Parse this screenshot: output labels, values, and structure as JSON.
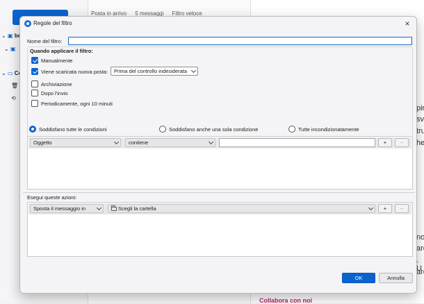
{
  "background": {
    "list_header": {
      "folder": "Posta in arrivo",
      "count": "5 messaggi",
      "quick_filter": "Filtro veloce"
    },
    "sidebar_fragments": [
      "be",
      "Ce"
    ],
    "reading_fragments": [
      "pir",
      "sv",
      "tru",
      "he",
      "no?",
      "are",
      ". U",
      "are"
    ],
    "reading_link": "Collabora con noi"
  },
  "dialog": {
    "title": "Regole del filtro",
    "name_label": "Nome del filtro:",
    "name_value": "",
    "when_heading": "Quando applicare il filtro:",
    "triggers": [
      {
        "label": "Manualmente",
        "checked": true
      },
      {
        "label": "Viene scaricata nuova posta:",
        "checked": true
      },
      {
        "label": "Archiviazione",
        "checked": false
      },
      {
        "label": "Dopo l'invio",
        "checked": false
      },
      {
        "label": "Periodicamente, ogni 10 minuti",
        "checked": false
      }
    ],
    "new_mail_timing": "Prima del controllo indesiderata",
    "match_options": [
      {
        "label": "Soddisfano tutte le condizioni",
        "selected": true
      },
      {
        "label": "Soddisfano anche una sola condizione",
        "selected": false
      },
      {
        "label": "Tutte incondizionatamente",
        "selected": false
      }
    ],
    "condition": {
      "field": "Oggetto",
      "operator": "contiene",
      "value": ""
    },
    "add_label": "+",
    "remove_label": "−",
    "actions_heading": "Esegui queste azioni:",
    "action": {
      "type": "Sposta il messaggio in",
      "target": "Scegli la cartella"
    },
    "ok_label": "OK",
    "cancel_label": "Annulla",
    "close_glyph": "×"
  },
  "colors": {
    "accent": "#0a64cf",
    "link": "#b8246b"
  }
}
